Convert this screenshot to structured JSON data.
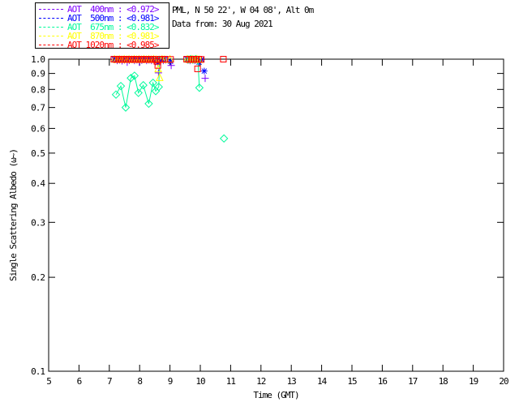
{
  "header": {
    "line1": "PML, N 50 22', W 04 08', Alt 0m",
    "line2": "Data from: 30 Aug 2021"
  },
  "legend": {
    "items": [
      {
        "label": "AOT  400nm : <0.972>",
        "color": "#7f00ff",
        "marker": "plus"
      },
      {
        "label": "AOT  500nm : <0.981>",
        "color": "#0000ff",
        "marker": "asterisk"
      },
      {
        "label": "AOT  675nm : <0.832>",
        "color": "#00fa9a",
        "marker": "diamond"
      },
      {
        "label": "AOT  870nm : <0.981>",
        "color": "#ffff00",
        "marker": "triangle"
      },
      {
        "label": "AOT 1020nm : <0.985>",
        "color": "#ff0000",
        "marker": "square"
      }
    ]
  },
  "chart_data": {
    "type": "scatter",
    "title": "",
    "xlabel": "Time (GMT)",
    "ylabel": "Single Scattering Albedo (ω~)",
    "xlim": [
      5,
      20
    ],
    "ylim": [
      0.1,
      1.0
    ],
    "yscale": "log",
    "grid": false,
    "x_ticks": [
      5,
      6,
      7,
      8,
      9,
      10,
      11,
      12,
      13,
      14,
      15,
      16,
      17,
      18,
      19,
      20
    ],
    "y_ticks": [
      "1.0",
      "0.9",
      "0.8",
      "0.7",
      "0.6",
      "0.5",
      "0.4",
      "0.3",
      "0.2",
      "0.1"
    ],
    "series": [
      {
        "name": "AOT 400nm",
        "mean": 0.972,
        "color": "#7f00ff",
        "marker": "plus",
        "connect": false,
        "points": [
          [
            7.18,
            0.998
          ],
          [
            7.26,
            0.99
          ],
          [
            7.34,
            0.995
          ],
          [
            7.42,
            0.988
          ],
          [
            7.5,
            0.995
          ],
          [
            7.59,
            0.978
          ],
          [
            7.66,
            0.992
          ],
          [
            7.75,
            0.997
          ],
          [
            7.83,
            0.99
          ],
          [
            7.91,
            0.995
          ],
          [
            7.99,
            0.978
          ],
          [
            8.07,
            0.992
          ],
          [
            8.15,
            0.997
          ],
          [
            8.23,
            0.99
          ],
          [
            8.31,
            0.995
          ],
          [
            8.39,
            0.99
          ],
          [
            8.47,
            0.995
          ],
          [
            8.56,
            0.99
          ],
          [
            8.62,
            0.904
          ],
          [
            8.7,
            0.995
          ],
          [
            8.78,
            0.99
          ],
          [
            8.86,
            0.995
          ],
          [
            9.04,
            0.955
          ],
          [
            9.58,
            0.995
          ],
          [
            9.66,
            0.99
          ],
          [
            9.74,
            0.995
          ],
          [
            9.82,
            0.99
          ],
          [
            9.9,
            0.995
          ],
          [
            9.98,
            0.99
          ],
          [
            10.16,
            0.868
          ]
        ]
      },
      {
        "name": "AOT 500nm",
        "mean": 0.981,
        "color": "#0000ff",
        "marker": "asterisk",
        "connect": false,
        "points": [
          [
            7.16,
            1.0
          ],
          [
            7.24,
            0.997
          ],
          [
            7.32,
            1.0
          ],
          [
            7.4,
            0.997
          ],
          [
            7.48,
            1.0
          ],
          [
            7.57,
            0.997
          ],
          [
            7.64,
            1.0
          ],
          [
            7.73,
            0.997
          ],
          [
            7.81,
            1.0
          ],
          [
            7.89,
            0.997
          ],
          [
            7.97,
            1.0
          ],
          [
            8.05,
            0.997
          ],
          [
            8.13,
            1.0
          ],
          [
            8.21,
            0.997
          ],
          [
            8.29,
            1.0
          ],
          [
            8.37,
            0.997
          ],
          [
            8.45,
            1.0
          ],
          [
            8.54,
            0.997
          ],
          [
            8.6,
            0.975
          ],
          [
            8.68,
            1.0
          ],
          [
            8.76,
            0.997
          ],
          [
            8.84,
            1.0
          ],
          [
            9.02,
            0.984
          ],
          [
            9.56,
            1.0
          ],
          [
            9.64,
            0.997
          ],
          [
            9.72,
            1.0
          ],
          [
            9.8,
            0.997
          ],
          [
            9.88,
            1.0
          ],
          [
            9.96,
            0.978
          ],
          [
            10.04,
            0.997
          ],
          [
            10.13,
            0.916
          ]
        ]
      },
      {
        "name": "AOT 675nm",
        "mean": 0.832,
        "color": "#00fa9a",
        "marker": "diamond",
        "connect": true,
        "segments": [
          [
            [
              7.22,
              0.77
            ],
            [
              7.38,
              0.82
            ],
            [
              7.54,
              0.7
            ],
            [
              7.71,
              0.87
            ],
            [
              7.83,
              0.885
            ],
            [
              7.96,
              0.78
            ],
            [
              8.12,
              0.825
            ],
            [
              8.3,
              0.72
            ],
            [
              8.44,
              0.84
            ],
            [
              8.53,
              0.79
            ],
            [
              8.63,
              0.815
            ],
            [
              8.66,
              0.995
            ]
          ],
          [
            [
              9.6,
              0.997
            ],
            [
              9.68,
              1.0
            ],
            [
              9.76,
              0.997
            ],
            [
              9.85,
              1.0
            ],
            [
              9.92,
              0.995
            ],
            [
              9.97,
              0.81
            ]
          ]
        ],
        "points": [
          [
            10.78,
            0.557
          ]
        ]
      },
      {
        "name": "AOT 870nm",
        "mean": 0.981,
        "color": "#ffff00",
        "marker": "triangle",
        "connect": false,
        "points": [
          [
            7.17,
            0.999
          ],
          [
            7.25,
            0.996
          ],
          [
            7.33,
            0.999
          ],
          [
            7.41,
            0.996
          ],
          [
            7.49,
            0.999
          ],
          [
            7.58,
            0.996
          ],
          [
            7.65,
            0.999
          ],
          [
            7.74,
            0.996
          ],
          [
            7.82,
            0.999
          ],
          [
            7.9,
            0.996
          ],
          [
            7.98,
            0.999
          ],
          [
            8.06,
            0.996
          ],
          [
            8.14,
            0.999
          ],
          [
            8.22,
            0.996
          ],
          [
            8.3,
            0.999
          ],
          [
            8.38,
            0.996
          ],
          [
            8.46,
            0.999
          ],
          [
            8.55,
            0.996
          ],
          [
            8.61,
            0.93
          ],
          [
            8.66,
            0.872
          ],
          [
            8.74,
            0.999
          ],
          [
            8.82,
            0.996
          ],
          [
            9.0,
            0.999
          ],
          [
            9.57,
            0.999
          ],
          [
            9.65,
            0.996
          ],
          [
            9.73,
            0.999
          ],
          [
            9.81,
            0.996
          ],
          [
            9.89,
            0.999
          ],
          [
            9.97,
            0.996
          ]
        ]
      },
      {
        "name": "AOT 1020nm",
        "mean": 0.985,
        "color": "#ff0000",
        "marker": "square",
        "connect": false,
        "points": [
          [
            7.15,
            1.0
          ],
          [
            7.23,
            0.998
          ],
          [
            7.31,
            1.0
          ],
          [
            7.39,
            0.998
          ],
          [
            7.47,
            1.0
          ],
          [
            7.55,
            0.998
          ],
          [
            7.63,
            1.0
          ],
          [
            7.71,
            0.998
          ],
          [
            7.79,
            1.0
          ],
          [
            7.87,
            0.998
          ],
          [
            7.95,
            1.0
          ],
          [
            8.03,
            0.998
          ],
          [
            8.11,
            1.0
          ],
          [
            8.19,
            0.998
          ],
          [
            8.27,
            1.0
          ],
          [
            8.35,
            0.998
          ],
          [
            8.43,
            1.0
          ],
          [
            8.51,
            0.998
          ],
          [
            8.57,
            0.984
          ],
          [
            8.6,
            0.955
          ],
          [
            8.67,
            1.0
          ],
          [
            8.75,
            0.998
          ],
          [
            8.83,
            1.0
          ],
          [
            9.02,
            0.998
          ],
          [
            9.55,
            1.0
          ],
          [
            9.63,
            0.998
          ],
          [
            9.71,
            1.0
          ],
          [
            9.79,
            0.998
          ],
          [
            9.87,
            1.0
          ],
          [
            9.91,
            0.931
          ],
          [
            9.95,
            1.0
          ],
          [
            10.03,
            0.998
          ],
          [
            10.76,
            1.0
          ]
        ]
      }
    ]
  }
}
